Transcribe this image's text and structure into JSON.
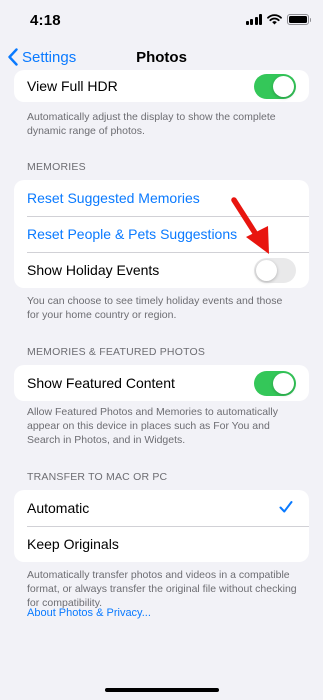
{
  "status": {
    "time": "4:18"
  },
  "nav": {
    "back_label": "Settings",
    "title": "Photos"
  },
  "hdr": {
    "label": "View Full HDR",
    "enabled": true,
    "footer": "Automatically adjust the display to show the complete dynamic range of photos."
  },
  "memories": {
    "header": "MEMORIES",
    "reset_suggested": "Reset Suggested Memories",
    "reset_people": "Reset People & Pets Suggestions",
    "holiday_label": "Show Holiday Events",
    "holiday_enabled": false,
    "footer": "You can choose to see timely holiday events and those for your home country or region."
  },
  "featured": {
    "header": "MEMORIES & FEATURED PHOTOS",
    "label": "Show Featured Content",
    "enabled": true,
    "footer": "Allow Featured Photos and Memories to automatically appear on this device in places such as For You and Search in Photos, and in Widgets."
  },
  "transfer": {
    "header": "TRANSFER TO MAC OR PC",
    "options": [
      "Automatic",
      "Keep Originals"
    ],
    "selected": "Automatic",
    "footer": "Automatically transfer photos and videos in a compatible format, or always transfer the original file without checking for compatibility."
  },
  "about_link": "About Photos & Privacy...",
  "colors": {
    "accent": "#0a7aff",
    "toggle_on": "#34c759",
    "arrow": "#e8150f"
  }
}
